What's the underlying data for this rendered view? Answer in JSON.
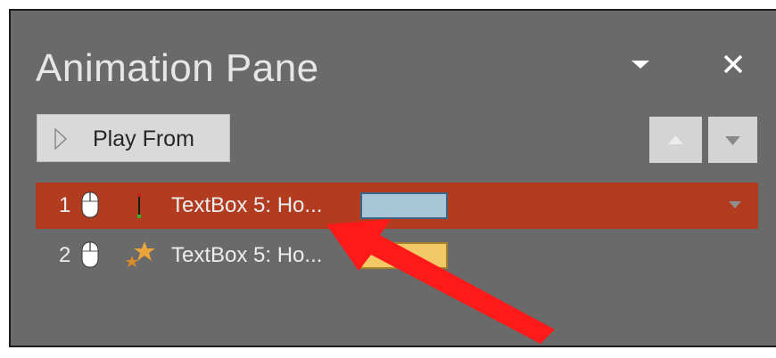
{
  "pane": {
    "title": "Animation Pane",
    "play_label": "Play From",
    "colors": {
      "background": "#6a6a6a",
      "selected_row": "#b13c20",
      "entrance_bar": "#a9c5d8",
      "emphasis_bar": "#f2c964",
      "annotation_arrow": "#ff1a1a"
    }
  },
  "animations": [
    {
      "number": "1",
      "label": "TextBox 5: Ho...",
      "effect_icon": "appear-effect-icon",
      "selected": true
    },
    {
      "number": "2",
      "label": "TextBox 5: Ho...",
      "effect_icon": "star-emphasis-icon",
      "selected": false
    }
  ]
}
